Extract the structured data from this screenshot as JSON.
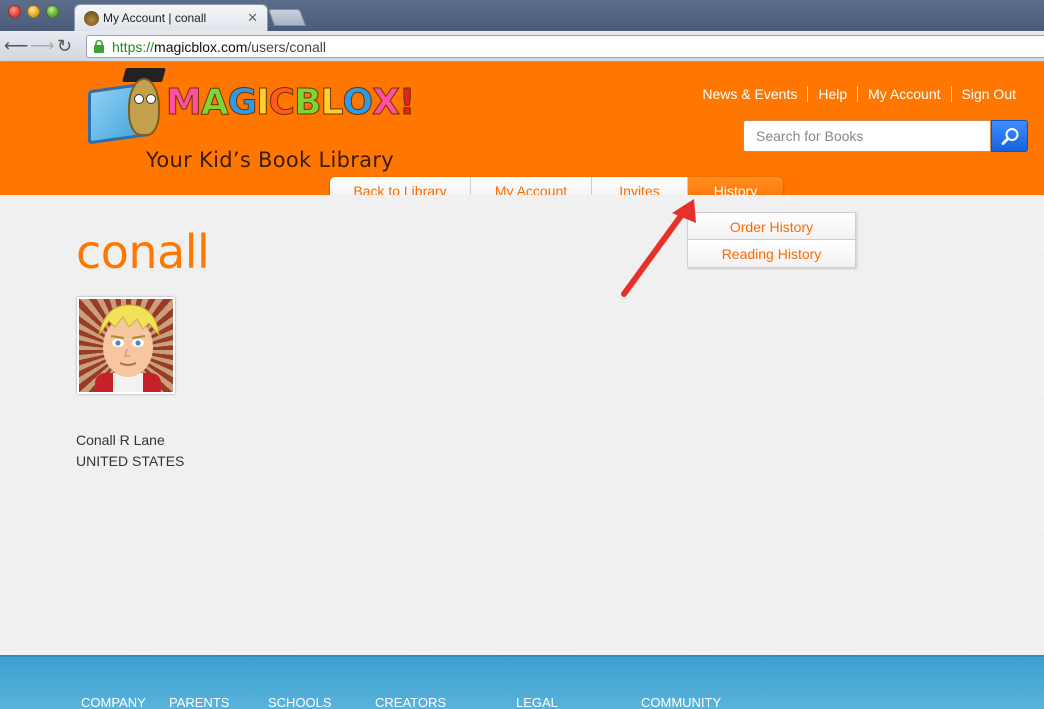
{
  "browser": {
    "tab_title": "My Account | conall",
    "url_scheme": "https://",
    "url_host": "magicblox.com",
    "url_path": "/users/conall"
  },
  "header": {
    "logo_letters": [
      "M",
      "A",
      "G",
      "I",
      "C",
      "B",
      "L",
      "O",
      "X",
      "!"
    ],
    "logo_colors": [
      "#ff4fa3",
      "#7cd63a",
      "#2f9be8",
      "#ffcf2e",
      "#ff5a1f",
      "#7cd63a",
      "#ffcf2e",
      "#2f9be8",
      "#ff4fa3",
      "#e8201f"
    ],
    "tagline": "Your Kid’s Book Library",
    "top_links": [
      "News & Events",
      "Help",
      "My Account",
      "Sign Out"
    ],
    "search_placeholder": "Search for Books"
  },
  "subnav": {
    "items": [
      "Back to Library",
      "My Account",
      "Invites",
      "History"
    ],
    "active": "History"
  },
  "history_menu": [
    "Order History",
    "Reading History"
  ],
  "profile": {
    "username": "conall",
    "full_name": "Conall R Lane",
    "country": "UNITED STATES"
  },
  "footer": {
    "columns": [
      "COMPANY",
      "PARENTS",
      "SCHOOLS",
      "CREATORS",
      "LEGAL",
      "COMMUNITY"
    ]
  },
  "colors": {
    "brand_orange": "#ff7700",
    "footer_blue": "#3ea0cf",
    "annotation_arrow": "#e8302a"
  }
}
